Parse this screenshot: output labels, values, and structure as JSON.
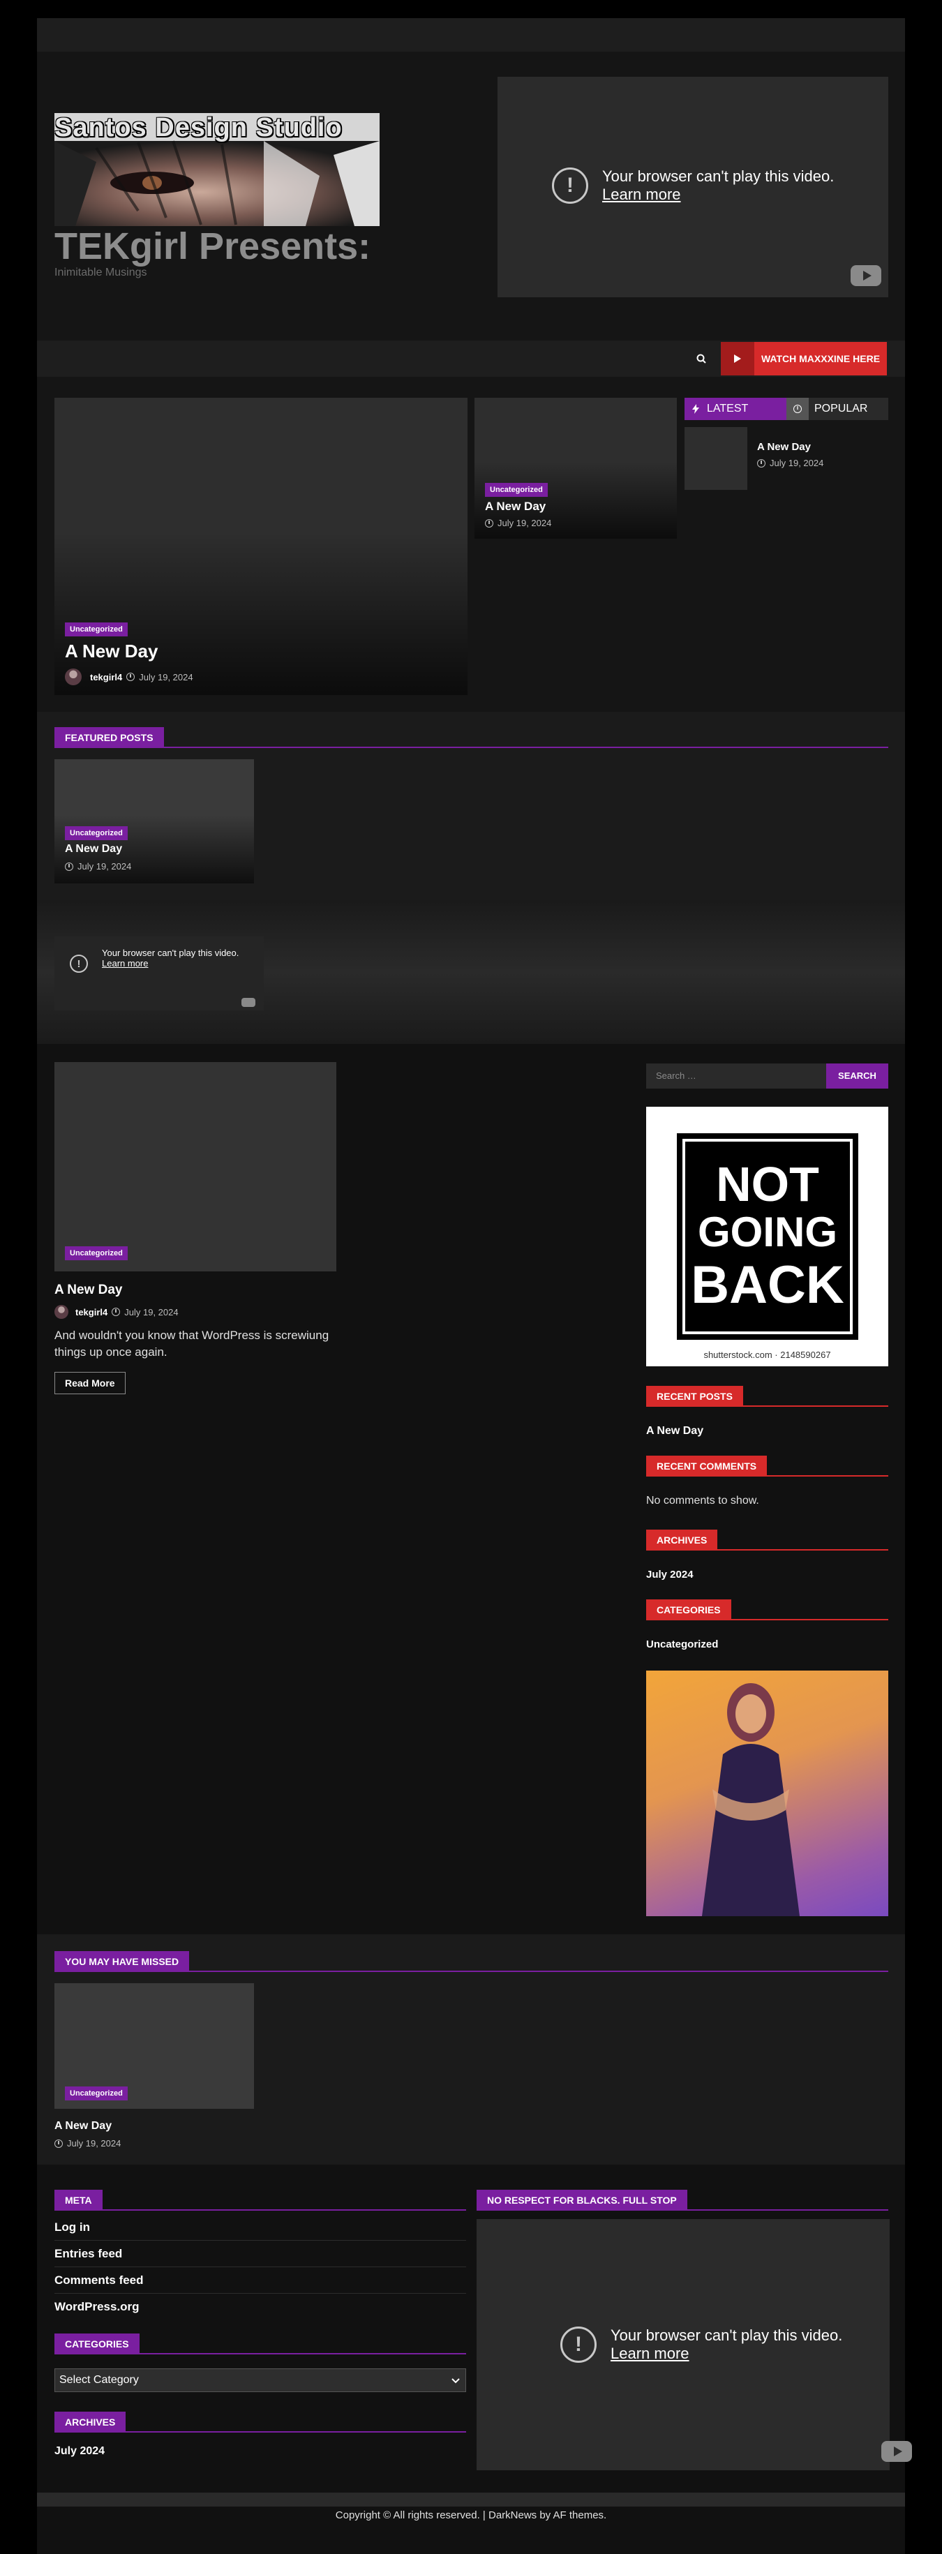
{
  "header": {
    "logo_text": "Santos Design Studio",
    "site_title": "TEKgirl Presents:",
    "tagline": "Inimitable Musings",
    "video": {
      "message": "Your browser can't play this video.",
      "link": "Learn more"
    }
  },
  "nav": {
    "watch_button": "WATCH MAXXXINE HERE"
  },
  "hero": {
    "main": {
      "category": "Uncategorized",
      "title": "A New Day",
      "author": "tekgirl4",
      "date": "July 19, 2024"
    },
    "side": {
      "category": "Uncategorized",
      "title": "A New Day",
      "date": "July 19, 2024"
    },
    "tabs": {
      "latest": "LATEST",
      "popular": "POPULAR"
    },
    "latest_item": {
      "title": "A New Day",
      "date": "July 19, 2024"
    }
  },
  "featured": {
    "heading": "FEATURED POSTS",
    "card": {
      "category": "Uncategorized",
      "title": "A New Day",
      "date": "July 19, 2024"
    }
  },
  "mid_video": {
    "message": "Your browser can't play this video.",
    "link": "Learn more"
  },
  "main_post": {
    "category": "Uncategorized",
    "title": "A New Day",
    "author": "tekgirl4",
    "date": "July 19, 2024",
    "excerpt": "And wouldn't you know that WordPress is screwiung things up once again.",
    "read_more": "Read More"
  },
  "sidebar": {
    "search_placeholder": "Search …",
    "search_button": "SEARCH",
    "ad": {
      "line1": "NOT",
      "line2": "GOING",
      "line3": "BACK",
      "caption": "shutterstock.com · 2148590267"
    },
    "recent_posts": {
      "heading": "RECENT POSTS",
      "items": [
        "A New Day"
      ]
    },
    "recent_comments": {
      "heading": "RECENT COMMENTS",
      "text": "No comments to show."
    },
    "archives": {
      "heading": "ARCHIVES",
      "items": [
        "July 2024"
      ]
    },
    "categories": {
      "heading": "CATEGORIES",
      "items": [
        "Uncategorized"
      ]
    }
  },
  "missed": {
    "heading": "YOU MAY HAVE MISSED",
    "card": {
      "category": "Uncategorized",
      "title": "A New Day",
      "date": "July 19, 2024"
    }
  },
  "footer_widgets": {
    "meta": {
      "heading": "META",
      "items": [
        "Log in",
        "Entries feed",
        "Comments feed",
        "WordPress.org"
      ]
    },
    "categories": {
      "heading": "CATEGORIES",
      "select_value": "Select Category"
    },
    "archives": {
      "heading": "ARCHIVES",
      "items": [
        "July 2024"
      ]
    },
    "video_heading": "NO RESPECT FOR BLACKS. FULL STOP",
    "video": {
      "message": "Your browser can't play this video.",
      "link": "Learn more"
    }
  },
  "copyright": "Copyright © All rights reserved. | DarkNews by AF themes.",
  "colors": {
    "accent_purple": "#7a1fa0",
    "accent_red": "#d72a2a",
    "background": "#111111"
  }
}
